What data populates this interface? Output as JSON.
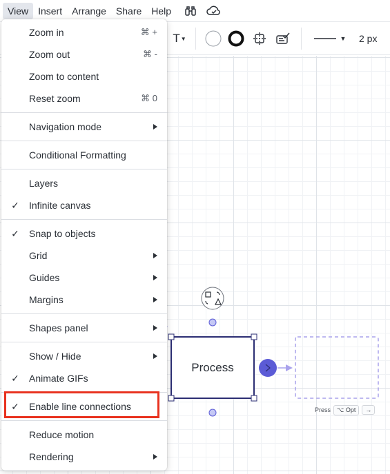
{
  "menubar": {
    "items": [
      "View",
      "Insert",
      "Arrange",
      "Share",
      "Help"
    ],
    "active": "View",
    "icons": [
      "binoculars-icon",
      "cloud-sync-icon"
    ]
  },
  "toolbar": {
    "text_tool": "T",
    "line_width": "2 px",
    "icons": [
      "text-format-icon",
      "fill-color-icon",
      "border-style-icon",
      "shape-options-icon",
      "conditional-format-icon",
      "line-style-icon"
    ]
  },
  "canvas": {
    "shape_label": "Process",
    "hint_text": "Press",
    "hint_key": "⌥ Opt",
    "hint_arrow": "→"
  },
  "menu": {
    "zoom_in": {
      "label": "Zoom in",
      "shortcut": "⌘ +"
    },
    "zoom_out": {
      "label": "Zoom out",
      "shortcut": "⌘ -"
    },
    "zoom_to_content": {
      "label": "Zoom to content"
    },
    "reset_zoom": {
      "label": "Reset zoom",
      "shortcut": "⌘ 0"
    },
    "navigation_mode": {
      "label": "Navigation mode"
    },
    "conditional_formatting": {
      "label": "Conditional Formatting"
    },
    "layers": {
      "label": "Layers"
    },
    "infinite_canvas": {
      "label": "Infinite canvas",
      "checked": true
    },
    "snap_to_objects": {
      "label": "Snap to objects",
      "checked": true
    },
    "grid": {
      "label": "Grid"
    },
    "guides": {
      "label": "Guides"
    },
    "margins": {
      "label": "Margins"
    },
    "shapes_panel": {
      "label": "Shapes panel"
    },
    "show_hide": {
      "label": "Show / Hide"
    },
    "animate_gifs": {
      "label": "Animate GIFs",
      "checked": true
    },
    "enable_line_connections": {
      "label": "Enable line connections",
      "checked": true
    },
    "reduce_motion": {
      "label": "Reduce motion"
    },
    "rendering": {
      "label": "Rendering"
    },
    "check_mark": "✓"
  },
  "colors": {
    "accent": "#5b5bd6",
    "highlight": "#e8321f",
    "shape_border": "#2b2d73",
    "ghost": "#a9a2ec"
  }
}
